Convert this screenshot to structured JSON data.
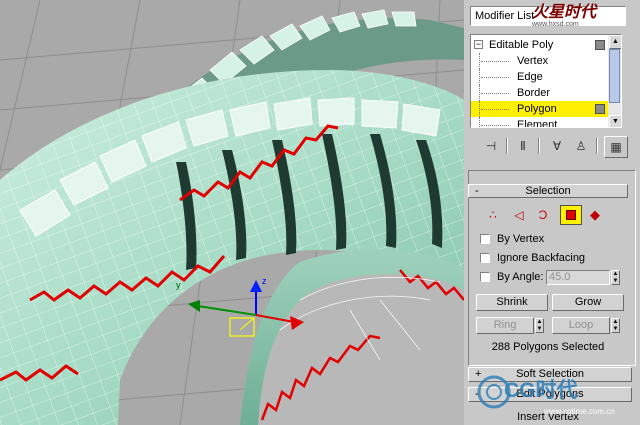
{
  "watermark_logo": "火星时代",
  "watermark_logo_url": "www.hxsd.com",
  "modifier_list": {
    "label": "Modifier List"
  },
  "modifier_stack": {
    "items": [
      {
        "label": "Editable Poly",
        "level": 0,
        "selected": false
      },
      {
        "label": "Vertex",
        "level": 1,
        "selected": false
      },
      {
        "label": "Edge",
        "level": 1,
        "selected": false
      },
      {
        "label": "Border",
        "level": 1,
        "selected": false
      },
      {
        "label": "Polygon",
        "level": 1,
        "selected": true
      },
      {
        "label": "Element",
        "level": 1,
        "selected": false
      }
    ]
  },
  "toolbar": {
    "icons": [
      "pin-stack-icon",
      "show-end-result-icon",
      "make-unique-icon",
      "remove-modifier-icon",
      "configure-modifier-sets-icon"
    ]
  },
  "selection_rollout": {
    "title": "Selection",
    "collapse_symbol": "-",
    "subobject_icons": [
      "vertex-icon",
      "edge-icon",
      "border-icon",
      "polygon-icon",
      "element-icon"
    ],
    "active_subobject": "polygon",
    "by_vertex": {
      "label": "By Vertex",
      "checked": false
    },
    "ignore_backfacing": {
      "label": "Ignore Backfacing",
      "checked": false
    },
    "by_angle": {
      "label": "By Angle:",
      "checked": false,
      "value": "45.0"
    },
    "shrink_label": "Shrink",
    "grow_label": "Grow",
    "ring_label": "Ring",
    "loop_label": "Loop",
    "status": "288 Polygons Selected"
  },
  "soft_selection": {
    "title": "Soft Selection",
    "symbol": "+"
  },
  "edit_polygons": {
    "title": "Edit Polygons",
    "symbol": "-"
  },
  "insert_vertex_label": "Insert Vertex",
  "watermark_brand": "CG时代",
  "watermark_url": "www.cgtime.com.cn",
  "colors": {
    "viewport_bg": "#a9a9a9",
    "tire_fill": "#bfe8d8",
    "tire_wire": "#ffffff",
    "selection_red": "#e00000",
    "highlight_yellow": "#ffef00",
    "panel_bg": "#c8c8c8"
  }
}
